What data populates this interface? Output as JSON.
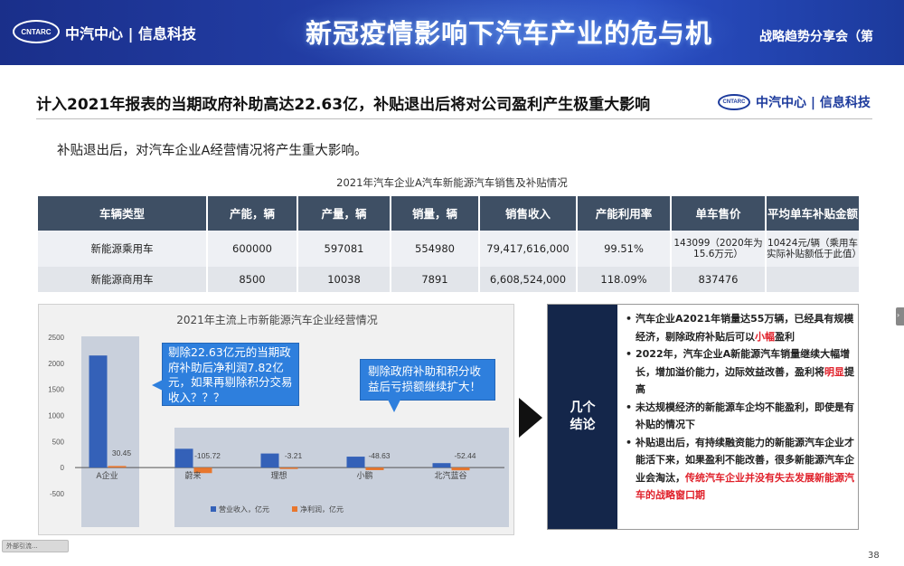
{
  "banner": {
    "logo_text": "CNTARC",
    "org": "中汽中心 | 信息科技",
    "title": "新冠疫情影响下汽车产业的危与机",
    "subtitle": "战略趋势分享会（第"
  },
  "heading": {
    "title": "计入2021年报表的当期政府补助高达22.63亿，补贴退出后将对公司盈利产生极重大影响",
    "logo_text": "CNTARC",
    "org": "中汽中心 | 信息科技"
  },
  "intro": "补贴退出后，对汽车企业A经营情况将产生重大影响。",
  "table": {
    "title": "2021年汽车企业A汽车新能源汽车销售及补贴情况",
    "headers": [
      "车辆类型",
      "产能，辆",
      "产量，辆",
      "销量，辆",
      "销售收入",
      "产能利用率",
      "单车售价",
      "平均单车补贴金额"
    ],
    "rows": [
      [
        "新能源乘用车",
        "600000",
        "597081",
        "554980",
        "79,417,616,000",
        "99.51%",
        "143099（2020年为15.6万元）",
        "10424元/辆（乘用车实际补贴额低于此值）"
      ],
      [
        "新能源商用车",
        "8500",
        "10038",
        "7891",
        "6,608,524,000",
        "118.09%",
        "837476",
        ""
      ]
    ]
  },
  "chart_data": {
    "type": "bar",
    "title": "2021年主流上市新能源汽车企业经营情况",
    "categories": [
      "A企业",
      "蔚来",
      "理想",
      "小鹏",
      "北汽蓝谷"
    ],
    "series": [
      {
        "name": "营业收入，亿元",
        "values": [
          2150,
          361,
          270,
          210,
          86
        ],
        "color": "#3461b8"
      },
      {
        "name": "净利润，亿元",
        "values": [
          30.45,
          -105.72,
          -3.21,
          -48.63,
          -52.44
        ],
        "color": "#e8772e"
      }
    ],
    "data_labels": [
      "30.45",
      "-105.72",
      "-3.21",
      "-48.63",
      "-52.44"
    ],
    "yticks": [
      "2500",
      "2000",
      "1500",
      "1000",
      "500",
      "0",
      "-500"
    ],
    "ylim": [
      -500,
      2500
    ],
    "legend_position": "bottom",
    "callouts": [
      "剔除22.63亿元的当期政府补助后净利润7.82亿元，如果再剔除积分交易收入？？？",
      "剔除政府补助和积分收益后亏损额继续扩大！"
    ]
  },
  "conclusion": {
    "label": "几个结论",
    "items": [
      {
        "parts": [
          {
            "t": "汽车企业A2021年销量达55万辆，已经具有规模经济，剔除政府补贴后可以"
          },
          {
            "t": "小幅",
            "red": true
          },
          {
            "t": "盈利"
          }
        ]
      },
      {
        "parts": [
          {
            "t": "2022年，汽车企业A新能源汽车销量继续大幅增长，增加溢价能力，边际效益改善，盈利将"
          },
          {
            "t": "明显",
            "red": true
          },
          {
            "t": "提高"
          }
        ]
      },
      {
        "parts": [
          {
            "t": "未达规模经济的新能源车企均不能盈利，即使是有补贴的情况下"
          }
        ]
      },
      {
        "parts": [
          {
            "t": "补贴退出后，有持续融资能力的新能源汽车企业才能活下来，如果盈利不能改善，很多新能源汽车企业会淘汰，"
          },
          {
            "t": "传统汽车企业并没有失去发展新能源汽车的战略窗口期",
            "red": true
          }
        ]
      }
    ]
  },
  "page_number": "38",
  "side_tab_glyph": "›",
  "thumbnail_label": "外部引流..."
}
